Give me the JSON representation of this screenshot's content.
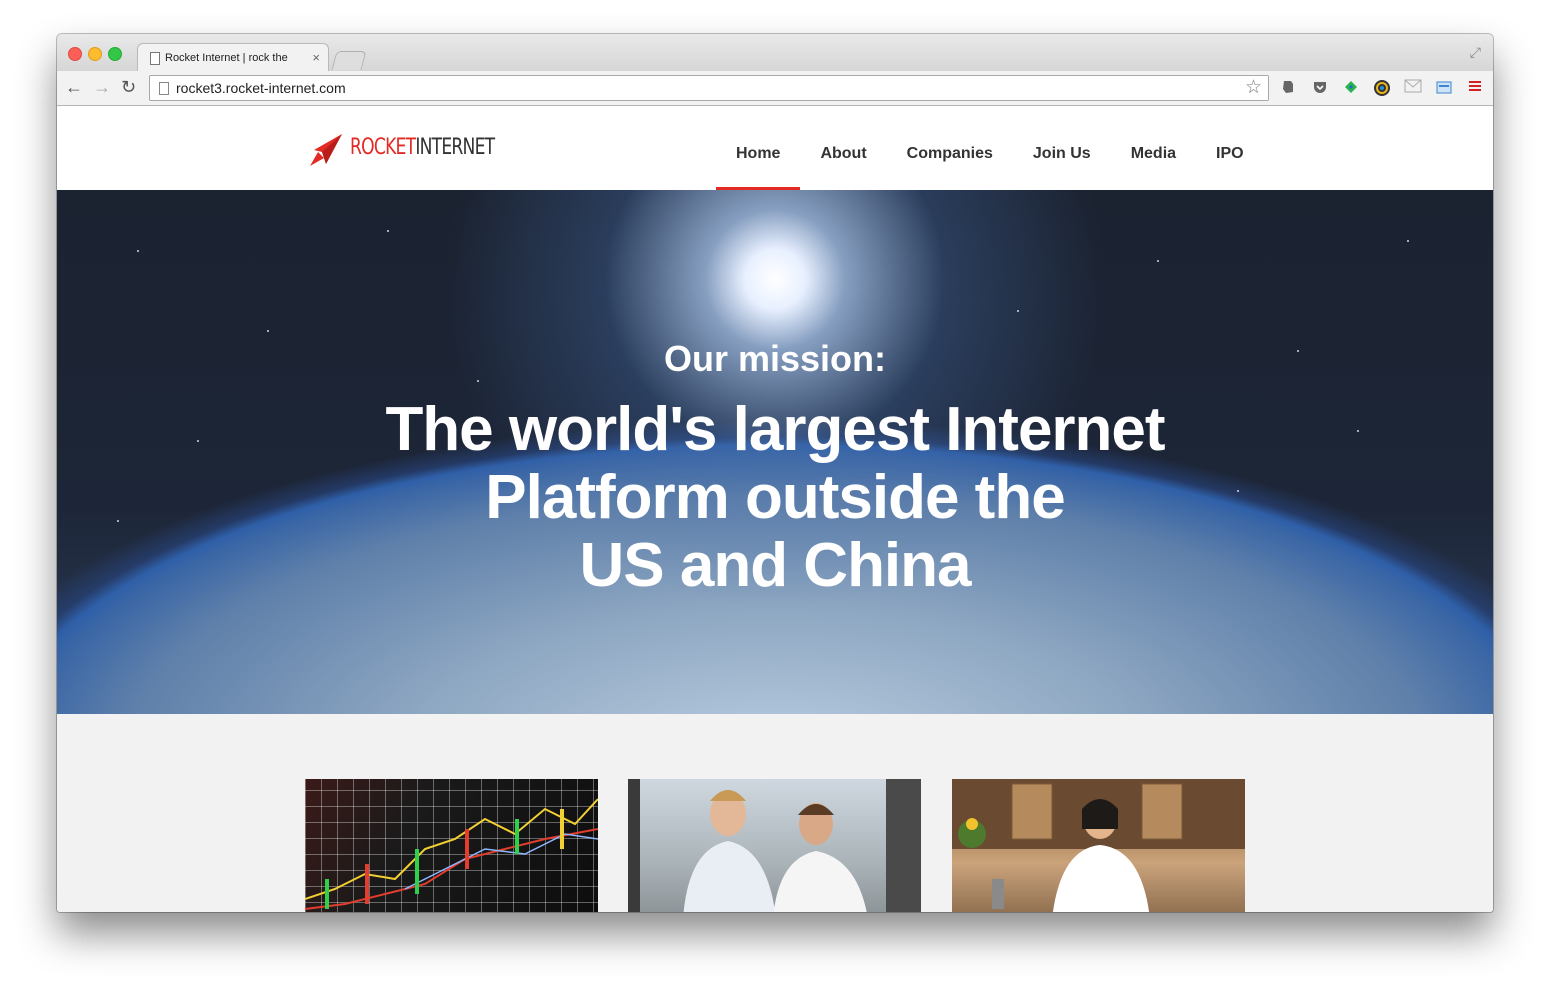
{
  "browser": {
    "tab_title": "Rocket Internet | rock the",
    "tab_close": "×",
    "url": "rocket3.rocket-internet.com",
    "nav": {
      "back": "←",
      "forward": "→",
      "reload": "↻"
    },
    "bookmark_icon": "☆",
    "fullscreen_icon": "⤢",
    "extensions": [
      "evernote-icon",
      "pocket-icon",
      "feedly-icon",
      "color-picker-icon",
      "mail-icon",
      "screenshot-icon",
      "menu-icon"
    ]
  },
  "site": {
    "logo": {
      "part1": "ROCKET",
      "part2": "INTERNET"
    },
    "nav": [
      {
        "label": "Home",
        "active": true
      },
      {
        "label": "About",
        "active": false
      },
      {
        "label": "Companies",
        "active": false
      },
      {
        "label": "Join Us",
        "active": false
      },
      {
        "label": "Media",
        "active": false
      },
      {
        "label": "IPO",
        "active": false
      }
    ],
    "hero": {
      "subtitle": "Our mission:",
      "title_line1": "The world's largest Internet",
      "title_line2": "Platform outside the",
      "title_line3": "US and China"
    }
  },
  "colors": {
    "accent": "#e42a25",
    "text": "#333333",
    "page_bg": "#f2f2f2"
  }
}
